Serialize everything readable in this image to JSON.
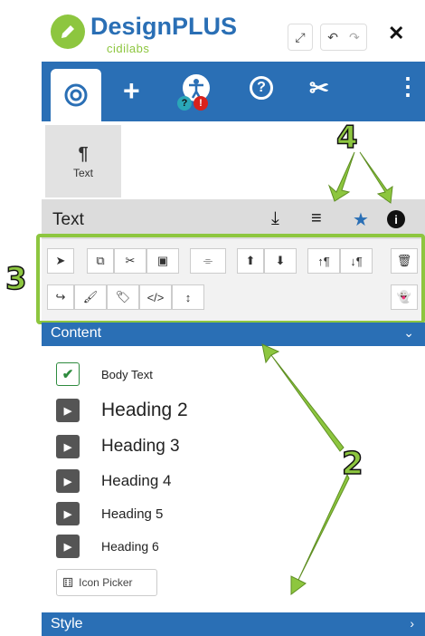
{
  "header": {
    "brand": "DesignPLUS",
    "sub": "cidilabs",
    "close": "✕"
  },
  "toolbar": {
    "items": [
      "target-icon",
      "plus-icon",
      "accessibility-icon",
      "help-icon",
      "tools-icon",
      "more-icon"
    ],
    "badges": {
      "question": "?",
      "alert": "!"
    }
  },
  "blocks": {
    "text_block": {
      "glyph": "¶",
      "label": "Text"
    }
  },
  "text_section": {
    "title": "Text"
  },
  "content_bar": {
    "label": "Content",
    "chevron": "⌄"
  },
  "content_items": [
    {
      "label": "Body Text",
      "checked": true
    },
    {
      "label": "Heading 2",
      "checked": false
    },
    {
      "label": "Heading 3",
      "checked": false
    },
    {
      "label": "Heading 4",
      "checked": false
    },
    {
      "label": "Heading 5",
      "checked": false
    },
    {
      "label": "Heading 6",
      "checked": false
    }
  ],
  "icon_picker": {
    "label": "Icon Picker"
  },
  "style_bar": {
    "label": "Style",
    "chevron": "›"
  },
  "annotations": {
    "a2": "2",
    "a3": "3",
    "a4": "4"
  },
  "colors": {
    "primary": "#2a6fb5",
    "accent_green": "#8dc63f"
  }
}
